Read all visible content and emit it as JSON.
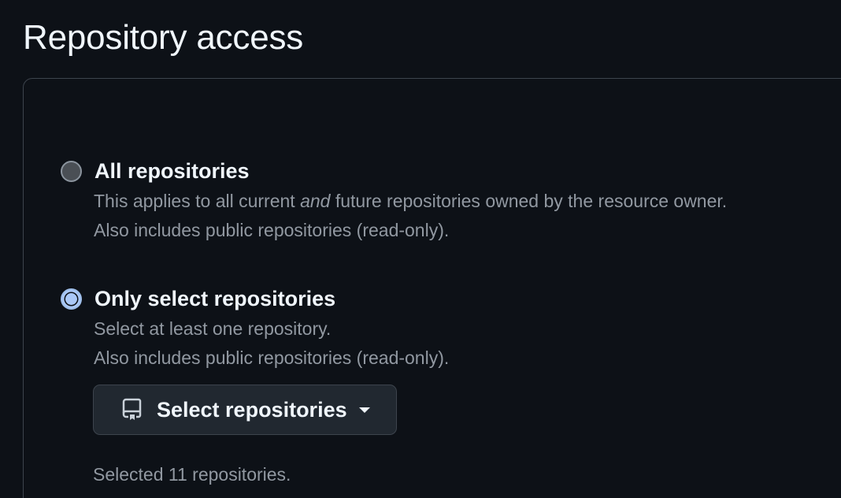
{
  "section": {
    "title": "Repository access"
  },
  "options": [
    {
      "label": "All repositories",
      "selected": false,
      "description_line1_before": "This applies to all current ",
      "description_line1_emphasis": "and",
      "description_line1_after": " future repositories owned by the resource owner.",
      "description_line2": "Also includes public repositories (read-only)."
    },
    {
      "label": "Only select repositories",
      "selected": true,
      "description_line1": "Select at least one repository.",
      "description_line2": "Also includes public repositories (read-only)."
    }
  ],
  "select_button": {
    "label": "Select repositories",
    "icon": "repo-icon",
    "dropdown_icon": "caret-down-icon"
  },
  "selected_count_text": "Selected 11 repositories.",
  "colors": {
    "background": "#0d1117",
    "border": "#3d444d",
    "primary_text": "#f0f6fc",
    "muted_text": "#9198a1",
    "radio_checked": "#aac8f7"
  }
}
